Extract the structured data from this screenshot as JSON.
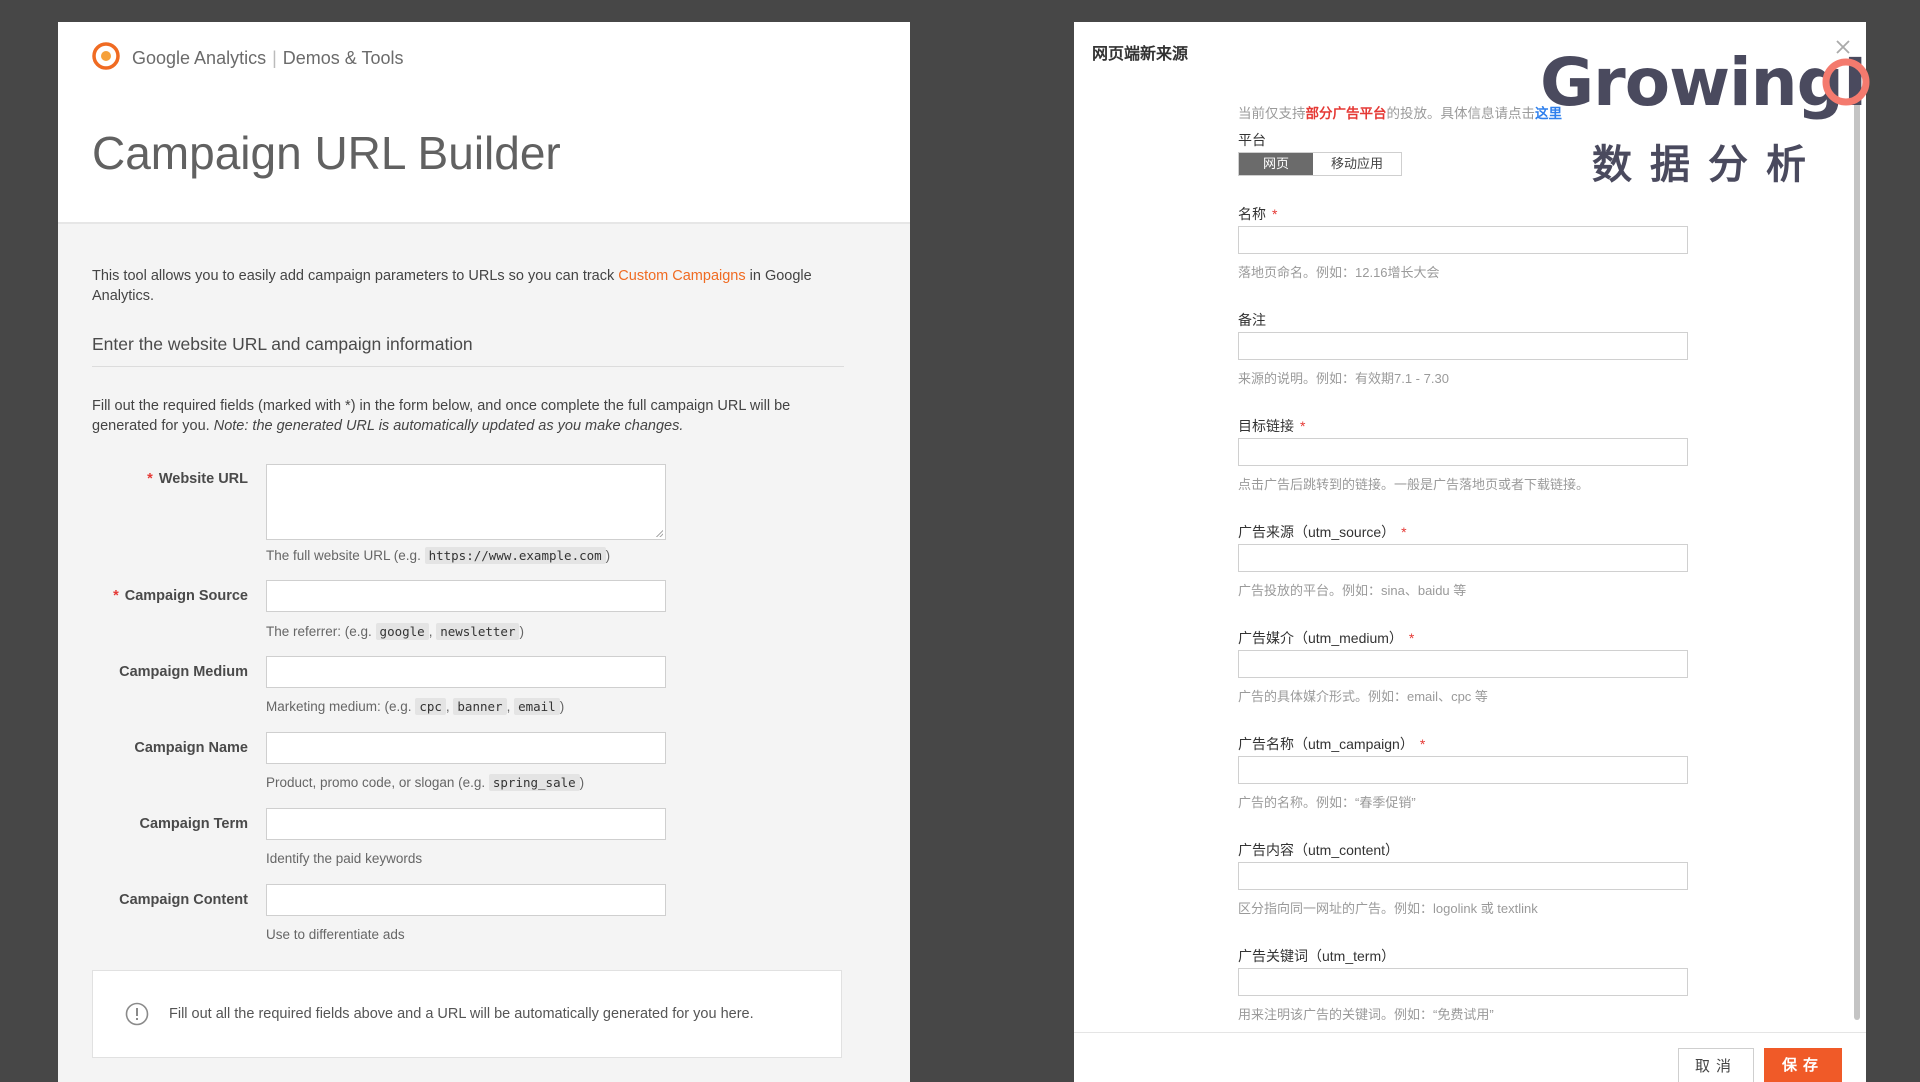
{
  "left": {
    "brand": "Google Analytics",
    "brand_suffix": "Demos & Tools",
    "page_title": "Campaign URL Builder",
    "intro_before": "This tool allows you to easily add campaign parameters to URLs so you can track ",
    "intro_link": "Custom Campaigns",
    "intro_after": " in Google Analytics.",
    "section_heading": "Enter the website URL and campaign information",
    "instructions_plain": "Fill out the required fields (marked with *) in the form below, and once complete the full campaign URL will be generated for you. ",
    "instructions_note": "Note: the generated URL is automatically updated as you make changes.",
    "fields": [
      {
        "label": "Website URL",
        "required": "*",
        "help_before": "The full website URL (e.g. ",
        "code1": "https://www.example.com",
        "help_after": ")"
      },
      {
        "label": "Campaign Source",
        "required": "*",
        "help_before": "The referrer: (e.g. ",
        "code1": "google",
        "sep1": ", ",
        "code2": "newsletter",
        "help_after": ")"
      },
      {
        "label": "Campaign Medium",
        "help_before": "Marketing medium: (e.g. ",
        "code1": "cpc",
        "sep1": ", ",
        "code2": "banner",
        "sep2": ", ",
        "code3": "email",
        "help_after": ")"
      },
      {
        "label": "Campaign Name",
        "help_before": "Product, promo code, or slogan (e.g. ",
        "code1": "spring_sale",
        "help_after": ")"
      },
      {
        "label": "Campaign Term",
        "help": "Identify the paid keywords"
      },
      {
        "label": "Campaign Content",
        "help": "Use to differentiate ads"
      }
    ],
    "notice": "Fill out all the required fields above and a URL will be automatically generated for you here."
  },
  "right": {
    "title": "网页端新来源",
    "notice_before": "当前仅支持",
    "notice_red": "部分广告平台",
    "notice_middle": "的投放。具体信息请点击",
    "notice_link": "这里",
    "platform_label": "平台",
    "platform_tabs": [
      "网页",
      "移动应用"
    ],
    "required_mark": "*",
    "fields": [
      {
        "label": "名称",
        "required": true,
        "help": "落地页命名。例如：12.16增长大会"
      },
      {
        "label": "备注",
        "required": false,
        "help": "来源的说明。例如：有效期7.1 - 7.30"
      },
      {
        "label": "目标链接",
        "required": true,
        "help": "点击广告后跳转到的链接。一般是广告落地页或者下载链接。"
      },
      {
        "label": "广告来源（utm_source）",
        "required": true,
        "help": "广告投放的平台。例如：sina、baidu 等"
      },
      {
        "label": "广告媒介（utm_medium）",
        "required": true,
        "help": "广告的具体媒介形式。例如：email、cpc 等"
      },
      {
        "label": "广告名称（utm_campaign）",
        "required": true,
        "help": "广告的名称。例如：“春季促销”"
      },
      {
        "label": "广告内容（utm_content）",
        "required": false,
        "help": "区分指向同一网址的广告。例如：logolink 或 textlink"
      },
      {
        "label": "广告关键词（utm_term）",
        "required": false,
        "help": "用来注明该广告的关键词。例如：“免费试用”"
      }
    ],
    "cancel_label": "取消",
    "save_label": "保存"
  },
  "watermark": {
    "word": "Growing",
    "word_suffix": "IO",
    "subtitle": "数据分析"
  },
  "colors": {
    "background": "#474747",
    "ga_orange": "#f06b22",
    "required_red": "#e53935",
    "save_orange": "#f05a28",
    "link_blue": "#2f80ed",
    "growing_gray": "#4a4a5e",
    "io_coral": "#f47a6e"
  }
}
